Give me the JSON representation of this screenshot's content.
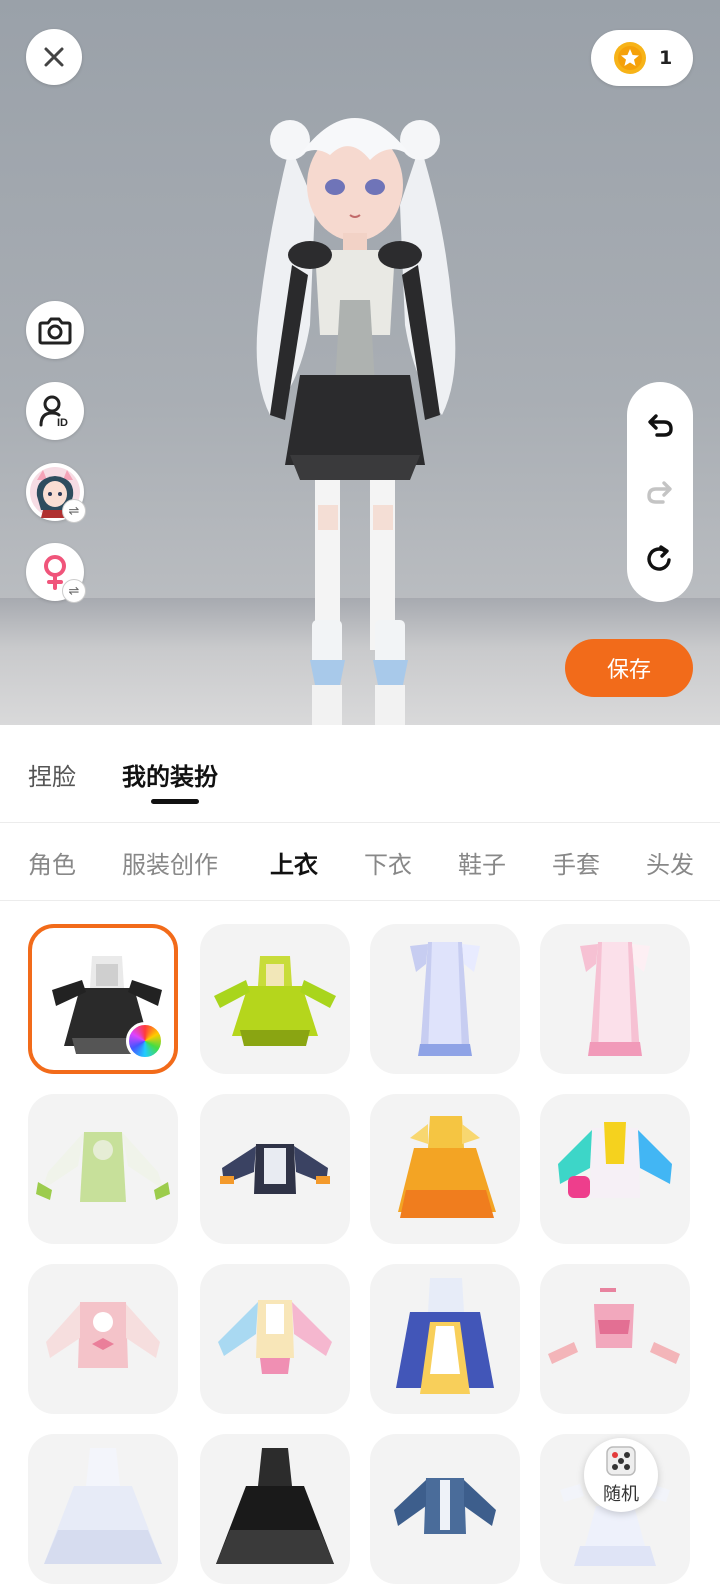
{
  "header": {
    "coin_count": "1"
  },
  "colors": {
    "accent": "#f26b1a",
    "stage_bg": "#a9aeb4",
    "tile_bg": "#f3f3f3"
  },
  "side_tools": [
    {
      "name": "camera",
      "icon": "camera-icon"
    },
    {
      "name": "profile-id",
      "icon": "user-id-icon"
    },
    {
      "name": "avatar-switch",
      "icon": "avatar-thumbnail"
    },
    {
      "name": "gender-switch",
      "icon": "female-icon"
    }
  ],
  "history": {
    "undo_icon": "undo-icon",
    "redo_icon": "redo-icon",
    "reset_icon": "reset-icon"
  },
  "actions": {
    "save_label": "保存",
    "random_label": "随机"
  },
  "top_tabs": [
    {
      "label": "捏脸",
      "active": false
    },
    {
      "label": "我的装扮",
      "active": true
    }
  ],
  "sub_tabs": [
    {
      "label": "角色",
      "active": false
    },
    {
      "label": "服装创作",
      "active": false
    },
    {
      "label": "上衣",
      "active": true
    },
    {
      "label": "下衣",
      "active": false
    },
    {
      "label": "鞋子",
      "active": false
    },
    {
      "label": "手套",
      "active": false
    },
    {
      "label": "头发",
      "active": false
    }
  ],
  "items": [
    {
      "name": "black-white-dress",
      "selected": true
    },
    {
      "name": "lime-green-dress",
      "selected": false
    },
    {
      "name": "lavender-robe",
      "selected": false
    },
    {
      "name": "pink-robe",
      "selected": false
    },
    {
      "name": "green-white-top",
      "selected": false
    },
    {
      "name": "dark-tech-jacket",
      "selected": false
    },
    {
      "name": "gold-orange-gown",
      "selected": false
    },
    {
      "name": "rainbow-hoodie",
      "selected": false
    },
    {
      "name": "pink-sweater",
      "selected": false
    },
    {
      "name": "pastel-gradient-jacket",
      "selected": false
    },
    {
      "name": "blue-yellow-gown",
      "selected": false
    },
    {
      "name": "pink-crop-top",
      "selected": false
    },
    {
      "name": "white-ball-gown",
      "selected": false
    },
    {
      "name": "black-ball-gown",
      "selected": false
    },
    {
      "name": "denim-jacket",
      "selected": false
    },
    {
      "name": "white-ruffle-set",
      "selected": false
    }
  ]
}
